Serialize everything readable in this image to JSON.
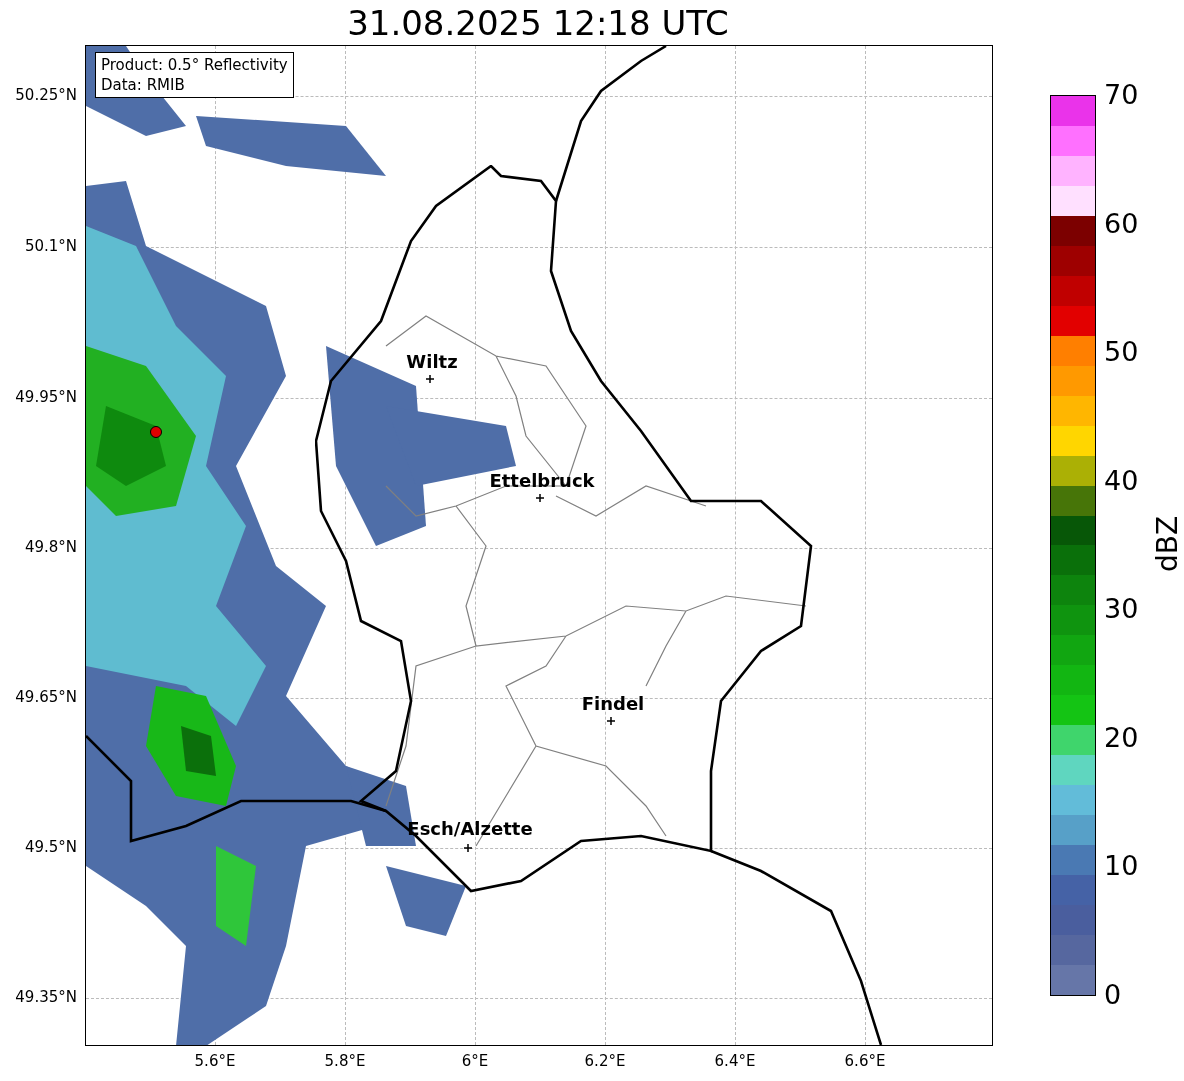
{
  "title": "31.08.2025 12:18 UTC",
  "info_box": [
    "Product: 0.5° Reflectivity",
    "Data: RMIB"
  ],
  "y_ticks": [
    "50.25°N",
    "50.1°N",
    "49.95°N",
    "49.8°N",
    "49.65°N",
    "49.5°N",
    "49.35°N"
  ],
  "x_ticks": [
    "5.6°E",
    "5.8°E",
    "6°E",
    "6.2°E",
    "6.4°E",
    "6.6°E"
  ],
  "cities": [
    {
      "name": "Wiltz"
    },
    {
      "name": "Ettelbruck"
    },
    {
      "name": "Findel"
    },
    {
      "name": "Esch/Alzette"
    }
  ],
  "colorbar": {
    "label": "dBZ",
    "ticks": [
      "70",
      "60",
      "50",
      "40",
      "30",
      "20",
      "10",
      "0"
    ]
  }
}
